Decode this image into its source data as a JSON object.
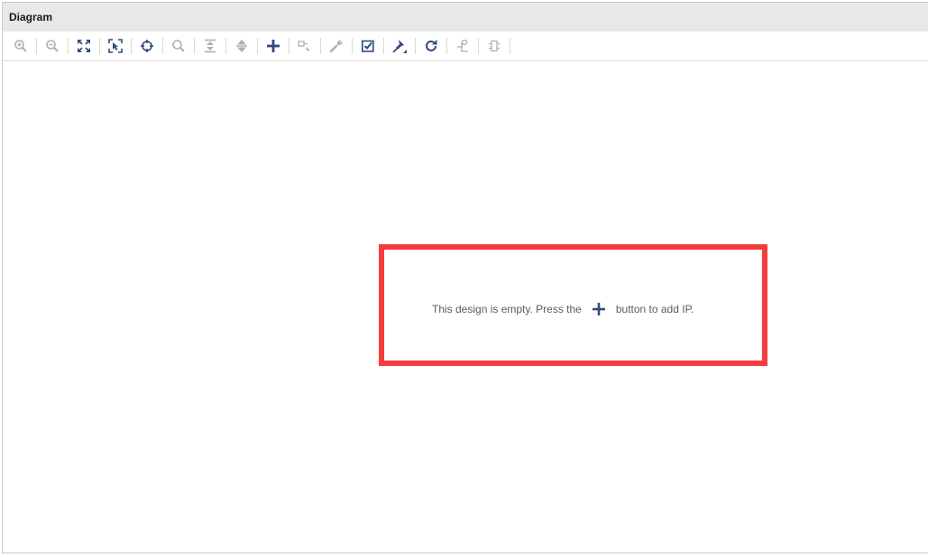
{
  "panel": {
    "title": "Diagram"
  },
  "toolbar": {
    "items": [
      {
        "icon": "zoom-in-icon",
        "enabled": false
      },
      {
        "icon": "zoom-out-icon",
        "enabled": false
      },
      {
        "icon": "zoom-fit-icon",
        "enabled": true
      },
      {
        "icon": "zoom-area-icon",
        "enabled": true
      },
      {
        "icon": "auto-center-icon",
        "enabled": true
      },
      {
        "icon": "search-icon",
        "enabled": false
      },
      {
        "icon": "collapse-all-icon",
        "enabled": false
      },
      {
        "icon": "expand-all-icon",
        "enabled": false
      },
      {
        "icon": "add-ip-icon",
        "enabled": true
      },
      {
        "icon": "make-connection-icon",
        "enabled": false
      },
      {
        "icon": "properties-wrench-icon",
        "enabled": false
      },
      {
        "icon": "validate-design-icon",
        "enabled": true
      },
      {
        "icon": "pin-icon",
        "enabled": true
      },
      {
        "icon": "regenerate-layout-icon",
        "enabled": true
      },
      {
        "icon": "run-connection-automation-icon",
        "enabled": false
      },
      {
        "icon": "run-block-automation-icon",
        "enabled": false
      }
    ]
  },
  "canvas": {
    "message_before": "This design is empty. Press the",
    "message_after": "button to add IP."
  },
  "colors": {
    "enabled_icon": "#2f4a7c",
    "disabled_icon": "#a9b0b8",
    "highlight": "#f43c3c",
    "message_text": "#555d66"
  }
}
